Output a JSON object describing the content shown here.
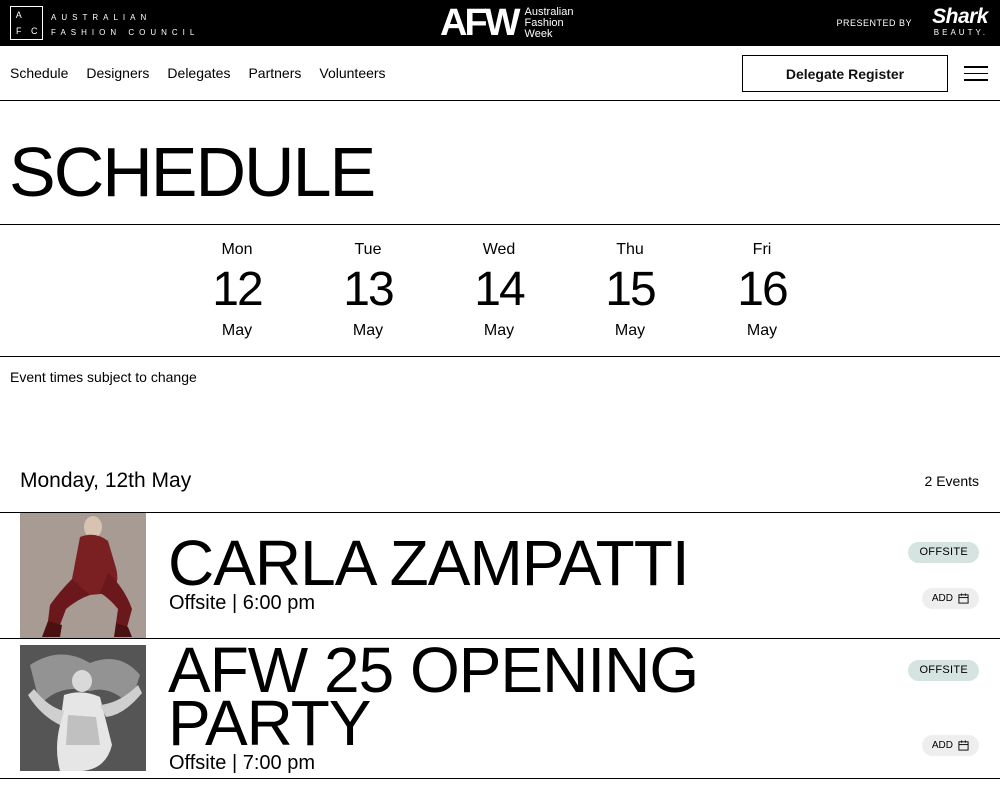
{
  "header": {
    "afc_logo_letters": [
      "A",
      "",
      "F",
      "C"
    ],
    "afc_line1": "AUSTRALIAN",
    "afc_line2": "FASHION COUNCIL",
    "afw_mark": "AFW",
    "afw_name_line1": "Australian",
    "afw_name_line2": "Fashion",
    "afw_name_line3": "Week",
    "presented_by": "PRESENTED BY",
    "sponsor_word": "Shark",
    "sponsor_sub": "BEAUTY."
  },
  "nav": {
    "links": [
      "Schedule",
      "Designers",
      "Delegates",
      "Partners",
      "Volunteers"
    ],
    "register_label": "Delegate Register",
    "menu_icon": "hamburger-icon"
  },
  "page_title": "SCHEDULE",
  "days": [
    {
      "name": "Mon",
      "date": "12",
      "month": "May"
    },
    {
      "name": "Tue",
      "date": "13",
      "month": "May"
    },
    {
      "name": "Wed",
      "date": "14",
      "month": "May"
    },
    {
      "name": "Thu",
      "date": "15",
      "month": "May"
    },
    {
      "name": "Fri",
      "date": "16",
      "month": "May"
    }
  ],
  "notice": "Event times subject to change",
  "section": {
    "heading": "Monday, 12th May",
    "count": "2 Events"
  },
  "events": [
    {
      "title": "CARLA ZAMPATTI",
      "meta": "Offsite | 6:00 pm",
      "tag": "OFFSITE",
      "add_label": "ADD"
    },
    {
      "title_line1": "AFW 25 OPENING",
      "title_line2": "PARTY",
      "meta": "Offsite | 7:00 pm",
      "tag": "OFFSITE",
      "add_label": "ADD"
    }
  ],
  "colors": {
    "topbar": "#000000",
    "pill": "#d5e3e1",
    "add_bg": "#eeeeee"
  }
}
